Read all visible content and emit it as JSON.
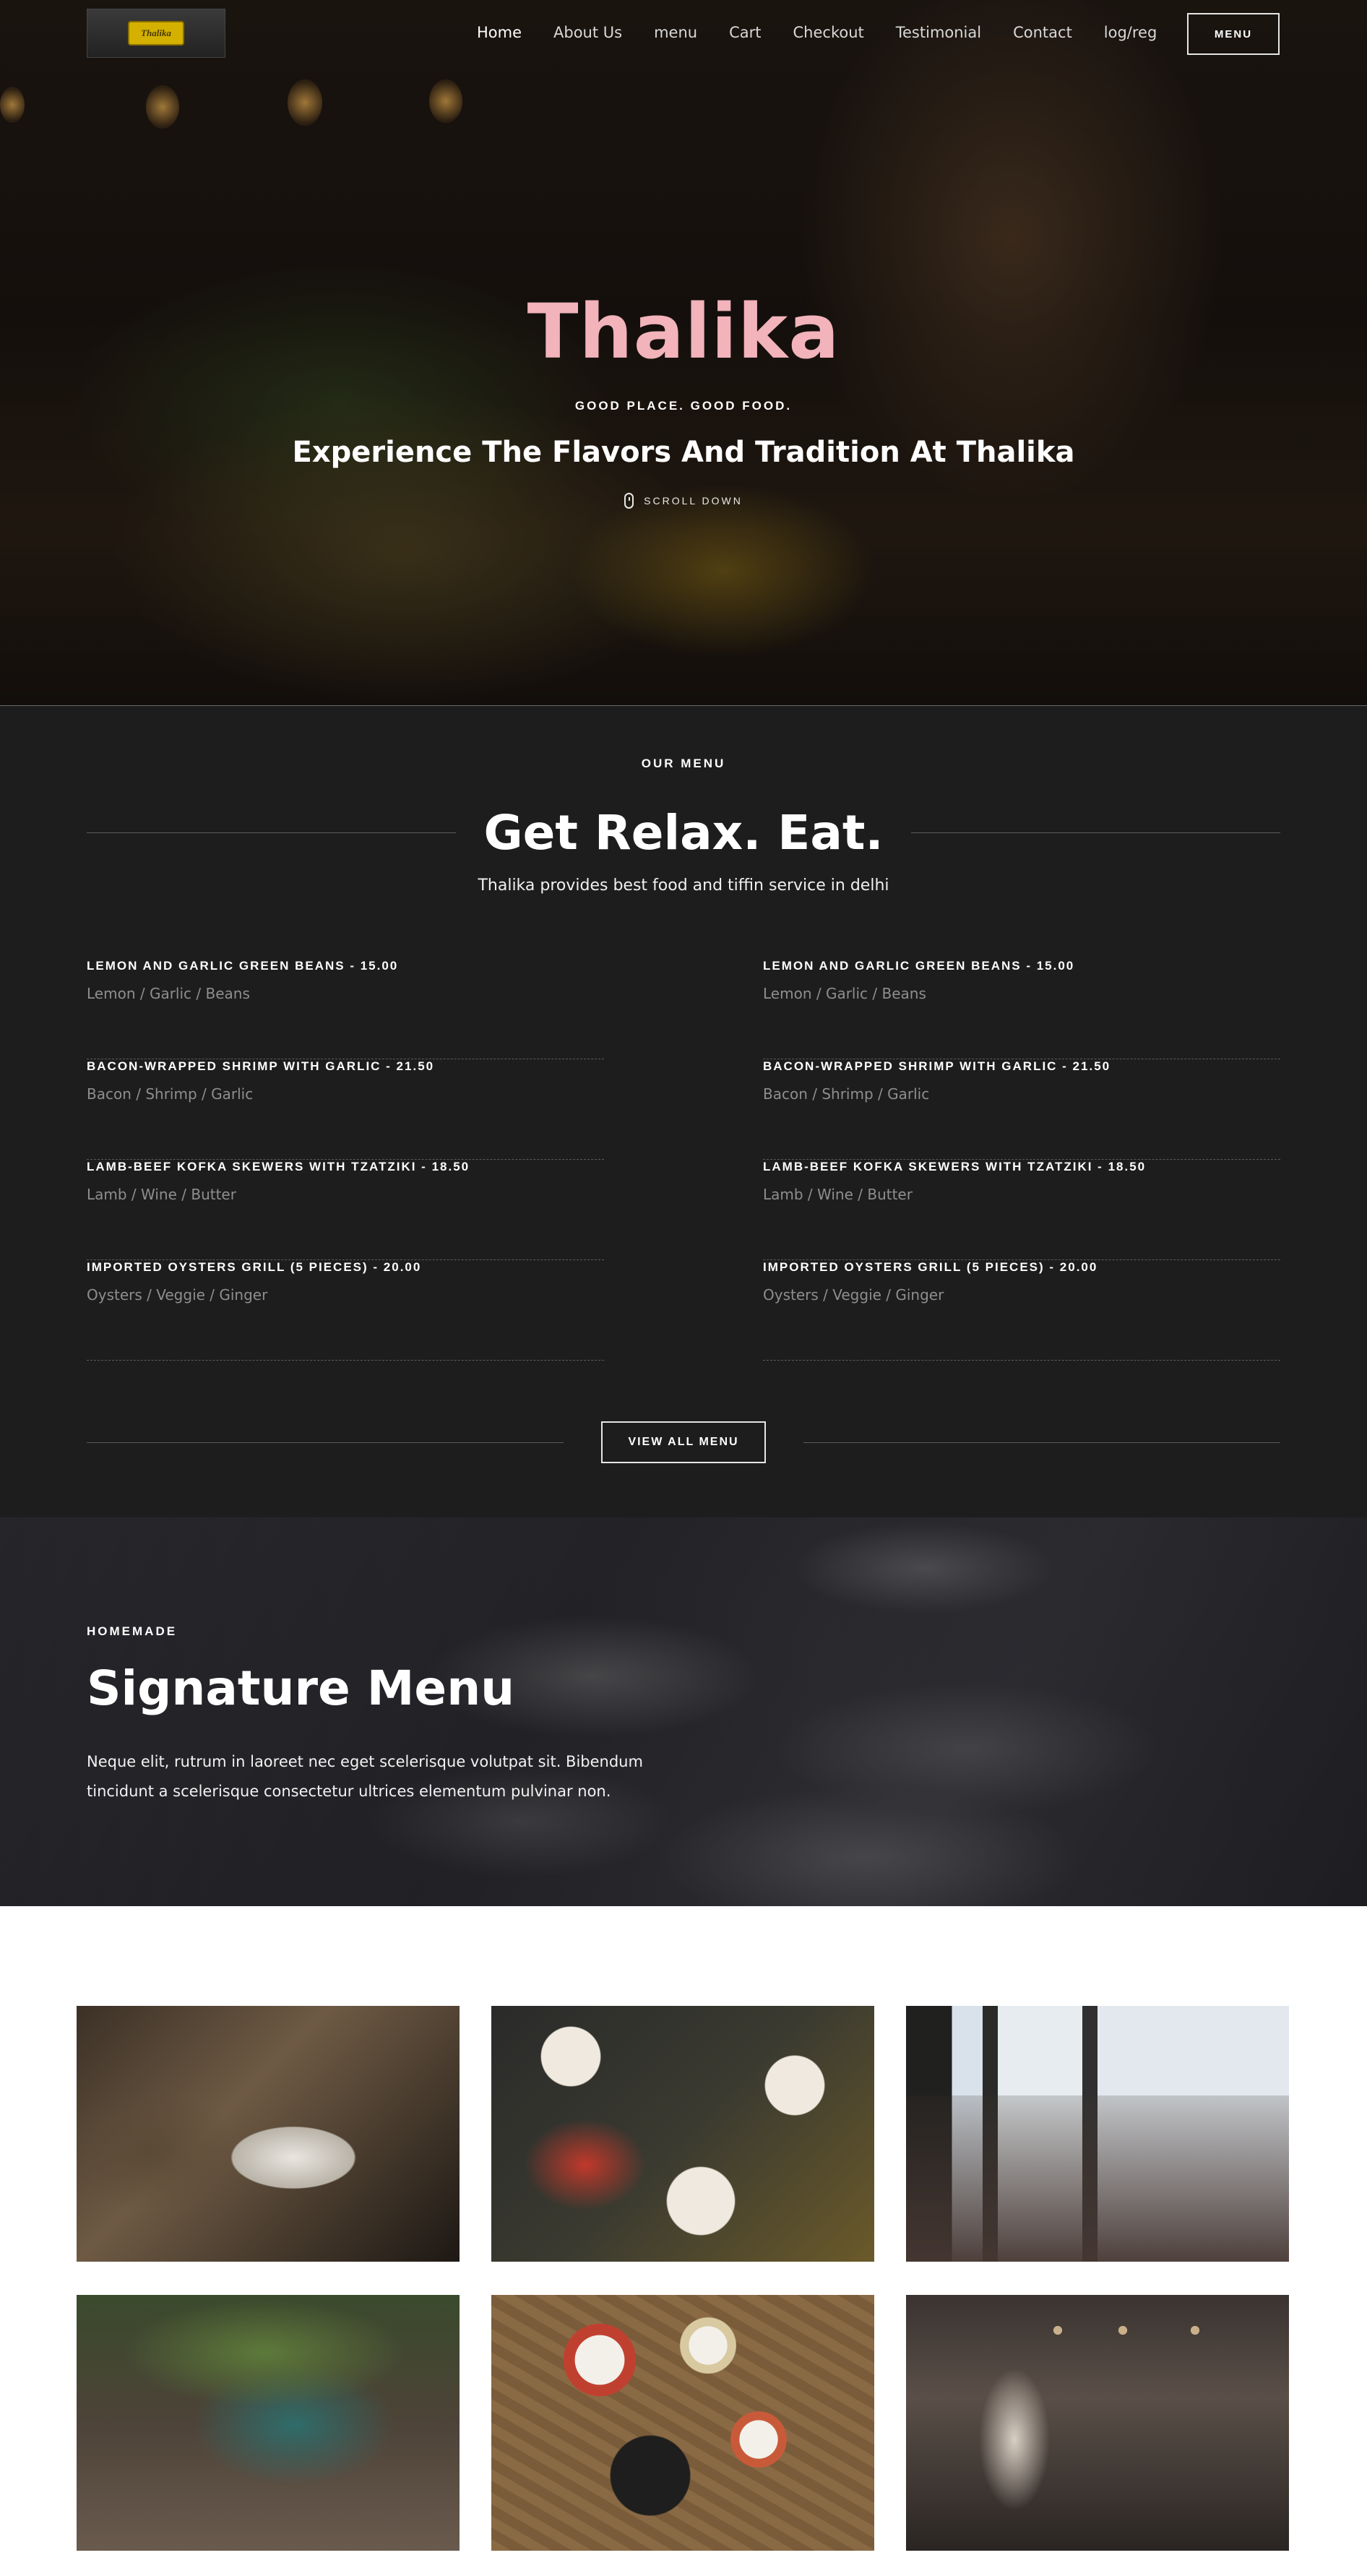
{
  "header": {
    "logo_text": "Thalika",
    "nav": [
      {
        "label": "Home",
        "active": true
      },
      {
        "label": "About Us"
      },
      {
        "label": "menu"
      },
      {
        "label": "Cart"
      },
      {
        "label": "Checkout"
      },
      {
        "label": "Testimonial"
      },
      {
        "label": "Contact"
      },
      {
        "label": "log/reg"
      }
    ],
    "menu_button": "MENU"
  },
  "hero": {
    "title": "Thalika",
    "kicker": "GOOD PLACE. GOOD FOOD.",
    "subtitle": "Experience The Flavors And Tradition At Thalika",
    "scroll_label": "SCROLL DOWN"
  },
  "menu_section": {
    "kicker": "OUR MENU",
    "title": "Get Relax. Eat.",
    "description": "Thalika  provides best food and tiffin service in delhi",
    "left_items": [
      {
        "name": "LEMON AND GARLIC GREEN BEANS - 15.00",
        "ingredients": "Lemon / Garlic / Beans"
      },
      {
        "name": "BACON-WRAPPED SHRIMP WITH GARLIC - 21.50",
        "ingredients": "Bacon / Shrimp / Garlic"
      },
      {
        "name": "LAMB-BEEF KOFKA SKEWERS WITH TZATZIKI - 18.50",
        "ingredients": "Lamb / Wine / Butter"
      },
      {
        "name": "IMPORTED OYSTERS GRILL (5 PIECES) - 20.00",
        "ingredients": "Oysters / Veggie / Ginger"
      }
    ],
    "right_items": [
      {
        "name": "LEMON AND GARLIC GREEN BEANS - 15.00",
        "ingredients": "Lemon / Garlic / Beans"
      },
      {
        "name": "BACON-WRAPPED SHRIMP WITH GARLIC - 21.50",
        "ingredients": "Bacon / Shrimp / Garlic"
      },
      {
        "name": "LAMB-BEEF KOFKA SKEWERS WITH TZATZIKI - 18.50",
        "ingredients": "Lamb / Wine / Butter"
      },
      {
        "name": "IMPORTED OYSTERS GRILL (5 PIECES) - 20.00",
        "ingredients": "Oysters / Veggie / Ginger"
      }
    ],
    "view_all_button": "VIEW ALL MENU"
  },
  "signature": {
    "kicker": "HOMEMADE",
    "title": "Signature Menu",
    "text": "Neque elit, rutrum in laoreet nec eget scelerisque volutpat sit. Bibendum tincidunt a scelerisque consectetur ultrices elementum pulvinar non."
  },
  "colors": {
    "hero_title": "#f2b3bb",
    "dark_bg": "#1d1d1e",
    "ingredient_text": "#8e8e8e"
  }
}
